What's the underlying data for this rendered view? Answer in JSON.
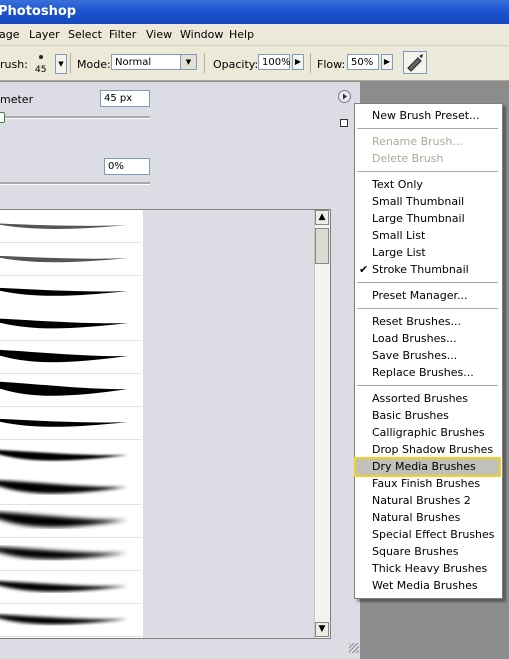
{
  "app": {
    "title": "Photoshop"
  },
  "menubar": {
    "items": [
      "age",
      "Layer",
      "Select",
      "Filter",
      "View",
      "Window",
      "Help"
    ]
  },
  "options": {
    "brush_label": "rush:",
    "brush_size": "45",
    "mode_label": "Mode:",
    "mode_value": "Normal",
    "opacity_label": "Opacity:",
    "opacity_value": "100%",
    "flow_label": "Flow:",
    "flow_value": "50%"
  },
  "panel": {
    "diameter_label": "meter",
    "diameter_value": "45 px",
    "hardness_value": "0%"
  },
  "flyout": {
    "items": [
      {
        "label": "New Brush Preset...",
        "state": "normal"
      },
      {
        "label": "Rename Brush...",
        "state": "disabled"
      },
      {
        "label": "Delete Brush",
        "state": "disabled"
      },
      {
        "label": "Text Only",
        "state": "normal"
      },
      {
        "label": "Small Thumbnail",
        "state": "normal"
      },
      {
        "label": "Large Thumbnail",
        "state": "normal"
      },
      {
        "label": "Small List",
        "state": "normal"
      },
      {
        "label": "Large List",
        "state": "normal"
      },
      {
        "label": "Stroke Thumbnail",
        "state": "checked"
      },
      {
        "label": "Preset Manager...",
        "state": "normal"
      },
      {
        "label": "Reset Brushes...",
        "state": "normal"
      },
      {
        "label": "Load Brushes...",
        "state": "normal"
      },
      {
        "label": "Save Brushes...",
        "state": "normal"
      },
      {
        "label": "Replace Brushes...",
        "state": "normal"
      },
      {
        "label": "Assorted Brushes",
        "state": "normal"
      },
      {
        "label": "Basic Brushes",
        "state": "normal"
      },
      {
        "label": "Calligraphic Brushes",
        "state": "normal"
      },
      {
        "label": "Drop Shadow Brushes",
        "state": "normal"
      },
      {
        "label": "Dry Media Brushes",
        "state": "highlighted"
      },
      {
        "label": "Faux Finish Brushes",
        "state": "normal"
      },
      {
        "label": "Natural Brushes 2",
        "state": "normal"
      },
      {
        "label": "Natural Brushes",
        "state": "normal"
      },
      {
        "label": "Special Effect Brushes",
        "state": "normal"
      },
      {
        "label": "Square Brushes",
        "state": "normal"
      },
      {
        "label": "Thick Heavy Brushes",
        "state": "normal"
      },
      {
        "label": "Wet Media Brushes",
        "state": "normal"
      }
    ],
    "check_glyph": "✔"
  },
  "icons": {
    "flyout_arrow": "triangle-right-circle",
    "scroll_up": "▲",
    "scroll_down": "▼",
    "spin_arrow": "▶",
    "dropdown_arrow": "▼"
  },
  "colors": {
    "highlight_border": "#f1d21e",
    "highlight_bg": "#c1c0ba",
    "titlebar": "#1d55cf"
  }
}
